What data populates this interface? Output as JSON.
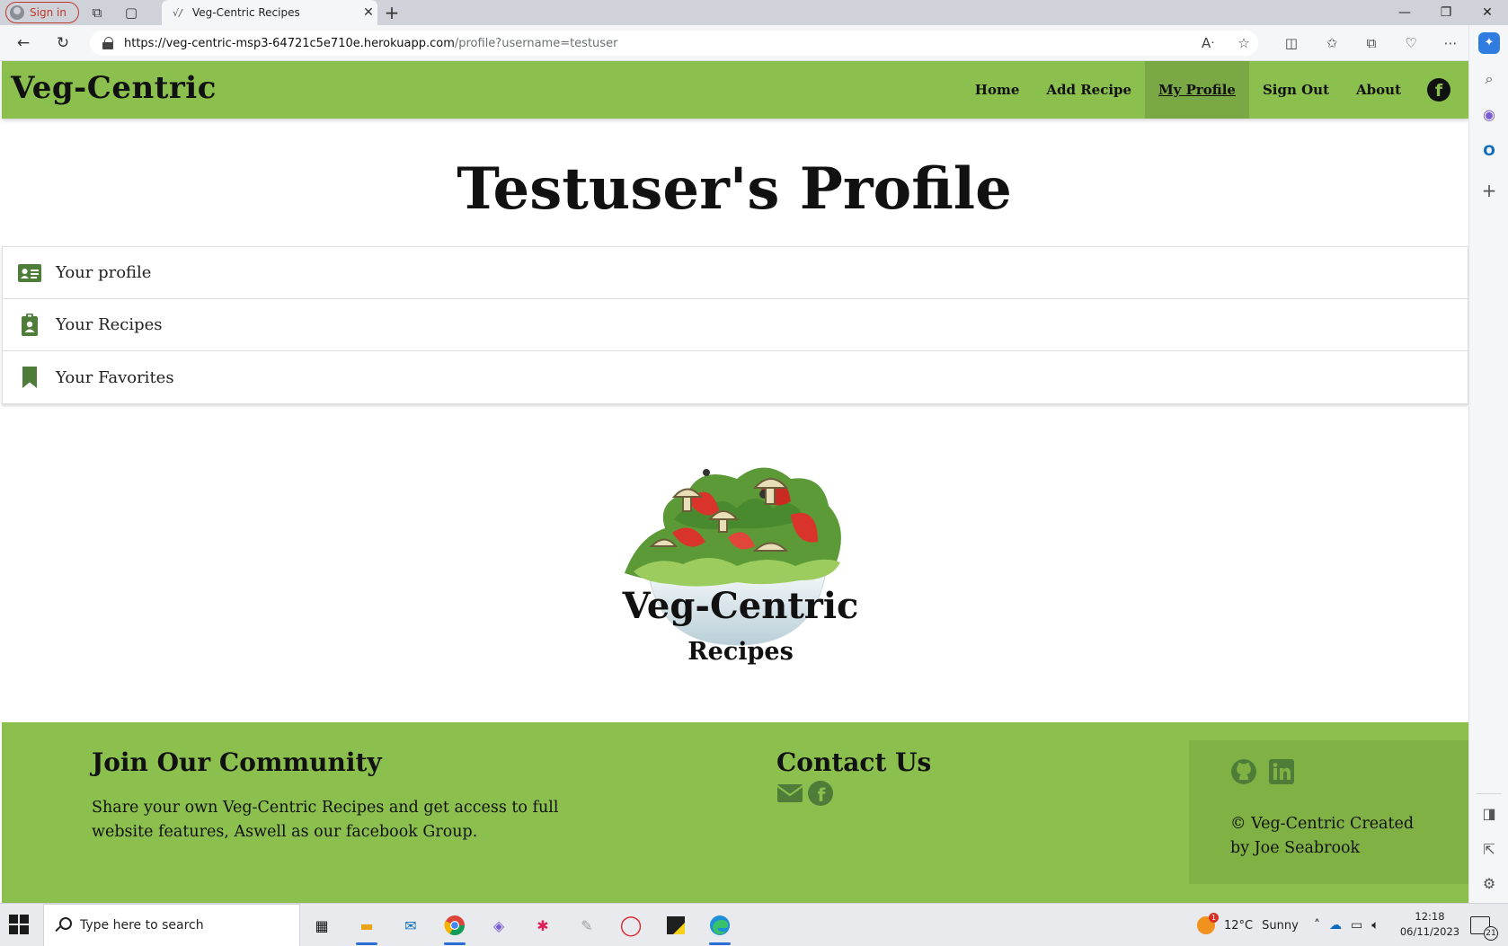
{
  "browser": {
    "signin_label": "Sign in",
    "tab_title": "Veg-Centric Recipes",
    "tab_close": "✕",
    "new_tab": "+",
    "url_host": "https://veg-centric-msp3-64721c5e710e.herokuapp.com",
    "url_path": "/profile?username=testuser",
    "window_controls": [
      "—",
      "❐",
      "✕"
    ]
  },
  "site": {
    "brand": "Veg-Centric",
    "nav": {
      "home": "Home",
      "add_recipe": "Add Recipe",
      "my_profile": "My Profile",
      "sign_out": "Sign Out",
      "about": "About",
      "facebook_glyph": "f"
    },
    "page_title": "Testuser's Profile",
    "collapsible": [
      {
        "label": "Your profile",
        "icon": "id-card-icon"
      },
      {
        "label": "Your Recipes",
        "icon": "clipboard-user-icon"
      },
      {
        "label": "Your Favorites",
        "icon": "bookmark-icon"
      }
    ],
    "logo": {
      "title": "Veg-Centric",
      "subtitle": "Recipes"
    },
    "footer": {
      "join_heading": "Join Our Community",
      "join_text": "Share your own Veg-Centric Recipes and get access to full website features, Aswell as our facebook Group.",
      "contact_heading": "Contact Us",
      "copyright": "© Veg-Centric Created by Joe Seabrook"
    },
    "colors": {
      "brand_green": "#8bbf4e",
      "active_green": "#7aa844",
      "footer_box_green": "#7fb145",
      "icon_green": "#4e7d3a"
    }
  },
  "taskbar": {
    "search_placeholder": "Type here to search",
    "weather_temp": "12°C",
    "weather_text": "Sunny",
    "time": "12:18",
    "date": "06/11/2023",
    "notification_count": "21",
    "weather_badge": "1"
  }
}
